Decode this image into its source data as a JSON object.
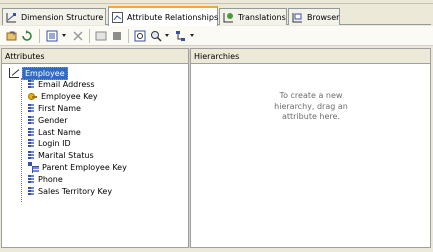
{
  "tabs": [
    {
      "label": "Dimension Structure",
      "active": false,
      "icon": "dimension-structure-icon"
    },
    {
      "label": "Attribute Relationships",
      "active": true,
      "icon": "attribute-relationships-icon"
    },
    {
      "label": "Translations",
      "active": false,
      "icon": "translations-icon"
    },
    {
      "label": "Browser",
      "active": false,
      "icon": "browser-icon"
    }
  ],
  "toolbar": {
    "icons": [
      "process-icon",
      "refresh-icon",
      "view-icon",
      "delete-icon",
      "grid-icon",
      "stop-icon",
      "zoom-fit-icon",
      "zoom-icon",
      "layout-icon"
    ]
  },
  "attributes_pane": {
    "header": "Attributes",
    "root": {
      "label": "Employee",
      "icon": "dimension-icon"
    },
    "items": [
      {
        "label": "Email Address",
        "icon": "attribute-icon"
      },
      {
        "label": "Employee Key",
        "icon": "key-attribute-icon"
      },
      {
        "label": "First Name",
        "icon": "attribute-icon"
      },
      {
        "label": "Gender",
        "icon": "attribute-icon"
      },
      {
        "label": "Last Name",
        "icon": "attribute-icon"
      },
      {
        "label": "Login ID",
        "icon": "attribute-icon"
      },
      {
        "label": "Marital Status",
        "icon": "attribute-icon"
      },
      {
        "label": "Parent Employee Key",
        "icon": "parent-attribute-icon"
      },
      {
        "label": "Phone",
        "icon": "attribute-icon"
      },
      {
        "label": "Sales Territory Key",
        "icon": "attribute-icon"
      }
    ]
  },
  "hierarchies_pane": {
    "header": "Hierarchies",
    "hint_line1": "To create a new",
    "hint_line2": "hierarchy, drag an",
    "hint_line3": "attribute here."
  },
  "colors": {
    "selection": "#316ac5",
    "active_tab_accent": "#f4a73a",
    "chrome": "#ece9d8"
  }
}
